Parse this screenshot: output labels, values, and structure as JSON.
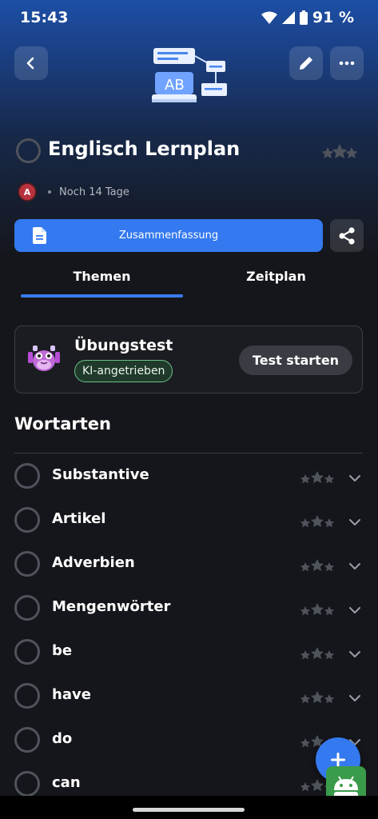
{
  "status_bar": {
    "time": "15:43",
    "battery": "91 %"
  },
  "header": {
    "back_icon": "chevron-left-icon",
    "edit_icon": "pencil-icon",
    "more_icon": "more-dots-icon",
    "illustration_text": "AB"
  },
  "plan": {
    "title": "Englisch Lernplan",
    "avatar_initial": "A",
    "due": "Noch 14 Tage"
  },
  "actions": {
    "summary_label": "Zusammenfassung",
    "share_icon": "share-icon"
  },
  "tabs": [
    {
      "label": "Themen",
      "active": true
    },
    {
      "label": "Zeitplan",
      "active": false
    }
  ],
  "test_card": {
    "title": "Übungstest",
    "badge": "KI-angetrieben",
    "button": "Test starten"
  },
  "section": {
    "title": "Wortarten"
  },
  "topics": [
    {
      "label": "Substantive"
    },
    {
      "label": "Artikel"
    },
    {
      "label": "Adverbien"
    },
    {
      "label": "Mengenwörter"
    },
    {
      "label": "be"
    },
    {
      "label": "have"
    },
    {
      "label": "do"
    },
    {
      "label": "can"
    }
  ],
  "colors": {
    "accent": "#3479ef",
    "background": "#15161b",
    "badge_border": "#6bbf8a",
    "star_gray": "#4f535c"
  }
}
